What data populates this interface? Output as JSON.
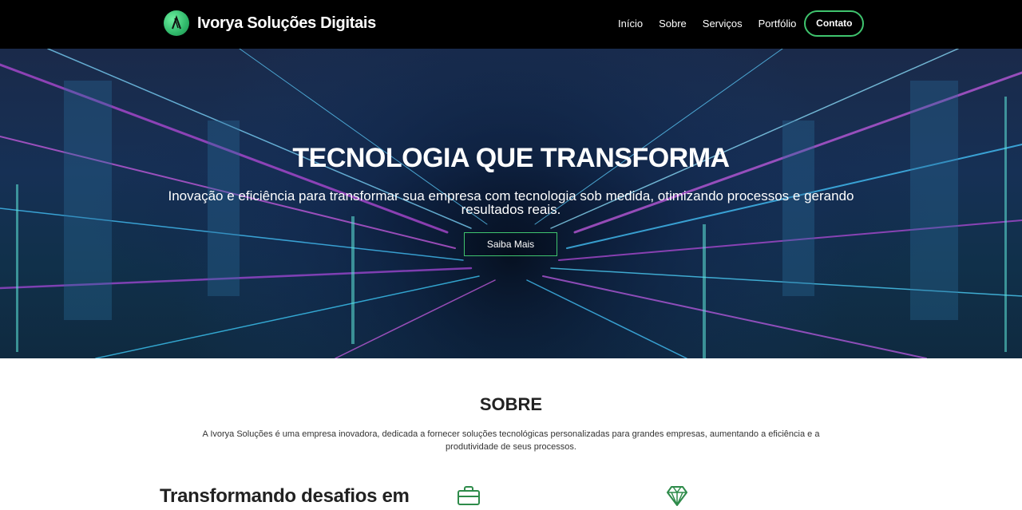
{
  "header": {
    "brand_name": "Ivorya Soluções Digitais",
    "nav": [
      {
        "label": "Início"
      },
      {
        "label": "Sobre"
      },
      {
        "label": "Serviços"
      },
      {
        "label": "Portfólio"
      }
    ],
    "cta_label": "Contato"
  },
  "hero": {
    "title": "TECNOLOGIA QUE TRANSFORMA",
    "subtitle_line1": "Inovação e eficiência para transformar sua empresa com tecnologia sob medida, otimizando processos e gerando",
    "subtitle_line2": "resultados reais.",
    "button_label": "Saiba Mais"
  },
  "about": {
    "title": "SOBRE",
    "text_line1": "A Ivorya Soluções é uma empresa inovadora, dedicada a fornecer soluções tecnológicas personalizadas para grandes empresas, aumentando a eficiência e a",
    "text_line2": "produtividade de seus processos."
  },
  "features": {
    "heading": "Transformando desafios em",
    "icons": [
      "briefcase-icon",
      "diamond-icon"
    ]
  },
  "colors": {
    "accent": "#3fc46e",
    "navbar": "#000000",
    "icon_green": "#2e8b4a"
  }
}
